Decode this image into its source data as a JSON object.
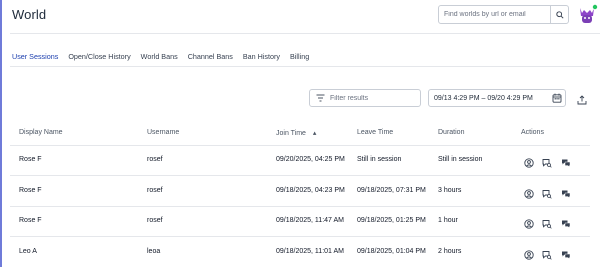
{
  "header": {
    "title": "World",
    "search_placeholder": "Find worlds by url or email"
  },
  "tabs": [
    {
      "label": "User Sessions",
      "active": true
    },
    {
      "label": "Open/Close History",
      "active": false
    },
    {
      "label": "World Bans",
      "active": false
    },
    {
      "label": "Channel Bans",
      "active": false
    },
    {
      "label": "Ban History",
      "active": false
    },
    {
      "label": "Billing",
      "active": false
    }
  ],
  "toolbar": {
    "filter_placeholder": "Filter results",
    "date_range": "09/13  4:29  PM  –  09/20  4:29  PM"
  },
  "table": {
    "columns": [
      "Display Name",
      "Username",
      "Join Time",
      "Leave Time",
      "Duration",
      "Actions"
    ],
    "sort_indicator": "▴",
    "rows": [
      {
        "display_name": "Rose F",
        "username": "rosef",
        "join_time": "09/20/2025, 04:25 PM",
        "leave_time": "Still in session",
        "duration": "Still in session"
      },
      {
        "display_name": "Rose F",
        "username": "rosef",
        "join_time": "09/18/2025, 04:23 PM",
        "leave_time": "09/18/2025, 07:31 PM",
        "duration": "3 hours"
      },
      {
        "display_name": "Rose F",
        "username": "rosef",
        "join_time": "09/18/2025, 11:47 AM",
        "leave_time": "09/18/2025, 01:25 PM",
        "duration": "1 hour"
      },
      {
        "display_name": "Leo A",
        "username": "leoa",
        "join_time": "09/18/2025, 11:01 AM",
        "leave_time": "09/18/2025, 01:04 PM",
        "duration": "2 hours"
      }
    ]
  },
  "colors": {
    "accent": "#2a52be",
    "left_rule": "#6f7bd9",
    "avatar": "#8e44c9",
    "online_dot": "#22c55e"
  }
}
